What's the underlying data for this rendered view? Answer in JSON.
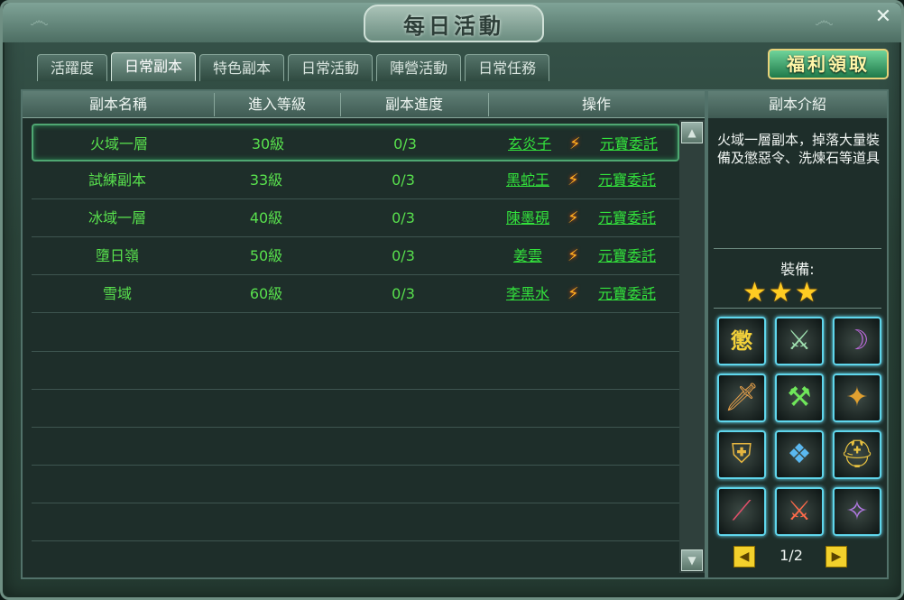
{
  "window": {
    "title": "每日活動"
  },
  "tabs": [
    "活躍度",
    "日常副本",
    "特色副本",
    "日常活動",
    "陣營活動",
    "日常任務"
  ],
  "welfare_button": "福利領取",
  "table": {
    "headers": [
      "副本名稱",
      "進入等級",
      "副本進度",
      "操作"
    ],
    "rows": [
      {
        "name": "火域一層",
        "level": "30級",
        "progress": "0/3",
        "npc": "玄炎子",
        "entrust": "元寶委託"
      },
      {
        "name": "試練副本",
        "level": "33級",
        "progress": "0/3",
        "npc": "黑蛇王",
        "entrust": "元寶委託"
      },
      {
        "name": "冰域一層",
        "level": "40級",
        "progress": "0/3",
        "npc": "陳墨硯",
        "entrust": "元寶委託"
      },
      {
        "name": "墮日嶺",
        "level": "50級",
        "progress": "0/3",
        "npc": "姜雲",
        "entrust": "元寶委託"
      },
      {
        "name": "雪域",
        "level": "60級",
        "progress": "0/3",
        "npc": "李黑水",
        "entrust": "元寶委託"
      }
    ]
  },
  "side": {
    "header": "副本介紹",
    "description": "火域一層副本，掉落大量裝備及懲惡令、洗煉石等道具",
    "equip_label": "裝備:",
    "star_rating": 3,
    "items": [
      {
        "icon": "badge-token-icon",
        "glyph": "懲"
      },
      {
        "icon": "green-blade-icon",
        "glyph": "⚔"
      },
      {
        "icon": "purple-scythe-icon",
        "glyph": "☽"
      },
      {
        "icon": "bronze-sword-icon",
        "glyph": "🗡"
      },
      {
        "icon": "jade-hilt-icon",
        "glyph": "⚒"
      },
      {
        "icon": "red-gold-armor-icon",
        "glyph": "✦"
      },
      {
        "icon": "gold-armor-icon",
        "glyph": "⛨"
      },
      {
        "icon": "blue-scale-armor-icon",
        "glyph": "❖"
      },
      {
        "icon": "gold-helm-icon",
        "glyph": "⛑"
      },
      {
        "icon": "crimson-staff-icon",
        "glyph": "⟋"
      },
      {
        "icon": "red-blade-icon",
        "glyph": "⚔"
      },
      {
        "icon": "violet-blade-icon",
        "glyph": "✧"
      }
    ],
    "pager": "1/2"
  },
  "colors": {
    "accent_green": "#33e23c",
    "frame": "#52726a",
    "gold": "#f3d12c",
    "slot_glow": "#5fd6ec"
  }
}
